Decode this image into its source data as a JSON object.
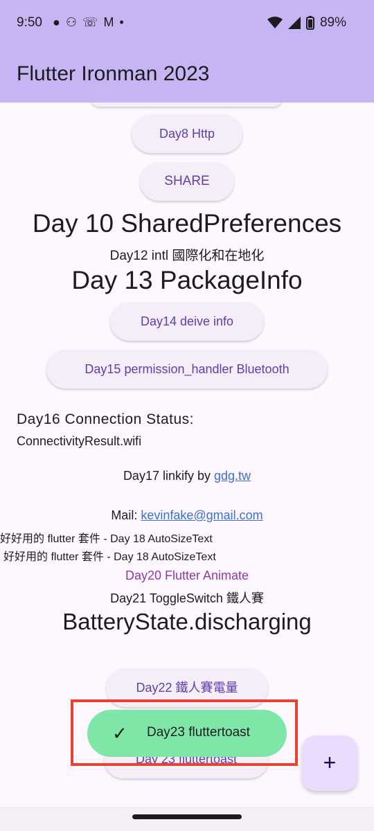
{
  "status_bar": {
    "time": "9:50",
    "battery_percent": "89%"
  },
  "app_bar": {
    "title": "Flutter Ironman 2023"
  },
  "content": {
    "day8_button": "Day8 Http",
    "share_button": "SHARE",
    "day10_title": "Day 10 SharedPreferences",
    "day12_text": "Day12 intl 國際化和在地化",
    "day13_title": "Day 13 PackageInfo",
    "day14_button": "Day14 deive info",
    "day15_button": "Day15 permission_handler Bluetooth",
    "day16_label": "Day16 Connection Status:",
    "day16_value": "ConnectivityResult.wifi",
    "day17_prefix": "Day17 linkify by ",
    "day17_link": "gdg.tw",
    "mail_prefix": "Mail: ",
    "mail_link": "kevinfake@gmail.com",
    "day18_text_1": "好好用的 flutter 套件 - Day 18 AutoSizeText",
    "day18_text_2": "好好用的 flutter 套件 - Day 18 AutoSizeText",
    "day20_text": "Day20 Flutter Animate",
    "day21_text": "Day21 ToggleSwitch 鐵人賽",
    "battery_state": "BatteryState.discharging",
    "day22_button": "Day22 鐵人賽電量",
    "day23_button": "Day 23 fluttertoast"
  },
  "toast": {
    "message": "Day23 fluttertoast"
  },
  "fab": {
    "label": "+"
  },
  "colors": {
    "app_bar": "#c6b4f3",
    "toast": "#7ee7a8",
    "highlight": "#e8432f",
    "link": "#3b6fd3",
    "button_text": "#5b3fb0"
  }
}
